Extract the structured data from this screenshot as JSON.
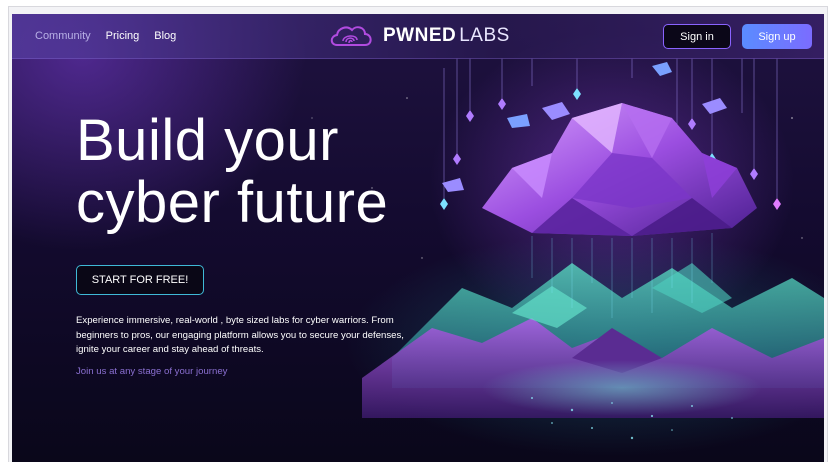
{
  "nav": {
    "links": [
      "Community",
      "Pricing",
      "Blog"
    ],
    "logo": {
      "brand": "PWNED",
      "suffix": "LABS",
      "icon": "cloud-fingerprint-logo"
    },
    "sign_in": "Sign in",
    "sign_up": "Sign up"
  },
  "hero": {
    "title_line1": "Build your",
    "title_line2": "cyber future",
    "cta": "START FOR FREE!",
    "description": "Experience immersive, real-world , byte sized labs for cyber warriors. From beginners to pros, our engaging platform allows you to secure your defenses, ignite your career and stay ahead of threats.",
    "join": "Join us at any stage of your journey"
  },
  "colors": {
    "accent_purple": "#8a63ff",
    "accent_cyan": "#3fb9d6",
    "signup_gradient": [
      "#5a8cff",
      "#7b6cff"
    ],
    "background_dark": "#140b30"
  },
  "illustration": "low-poly cloud over glowing crystal mountains"
}
